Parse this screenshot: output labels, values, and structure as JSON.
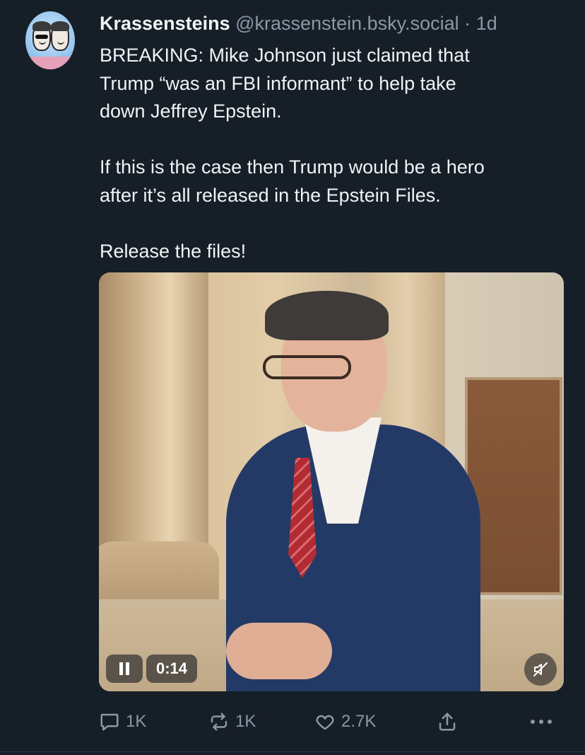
{
  "post": {
    "author_name": "Krassensteins",
    "author_handle": "@krassenstein.bsky.social",
    "separator": "·",
    "time": "1d",
    "text_paragraphs": [
      "BREAKING: Mike Johnson just claimed that\nTrump “was an FBI informant” to help take\ndown Jeffrey Epstein.",
      "If this is the case then Trump would be a hero\nafter it’s all released in the Epstein Files.",
      "Release the files!"
    ]
  },
  "video": {
    "state": "playing",
    "elapsed": "0:14",
    "muted": true
  },
  "actions": {
    "replies": "1K",
    "reposts": "1K",
    "likes": "2.7K"
  },
  "colors": {
    "background": "#161e27",
    "text": "#f1f3f5",
    "muted_text": "#8b98a6"
  },
  "icons": {
    "reply": "speech-bubble-icon",
    "repost": "repost-arrows-icon",
    "like": "heart-icon",
    "share": "share-upload-icon",
    "more": "more-dots-icon",
    "pause": "pause-icon",
    "mute": "speaker-muted-icon"
  }
}
